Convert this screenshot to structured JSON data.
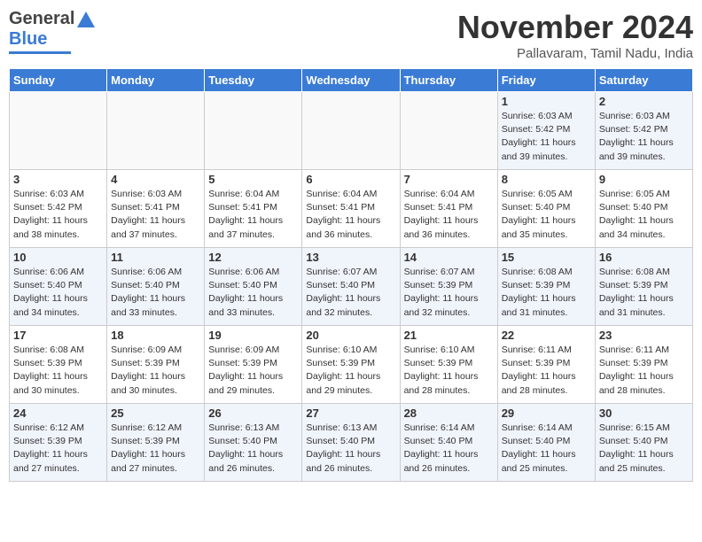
{
  "logo": {
    "general": "General",
    "blue": "Blue"
  },
  "header": {
    "month_title": "November 2024",
    "location": "Pallavaram, Tamil Nadu, India"
  },
  "weekdays": [
    "Sunday",
    "Monday",
    "Tuesday",
    "Wednesday",
    "Thursday",
    "Friday",
    "Saturday"
  ],
  "rows": [
    [
      {
        "day": "",
        "info": ""
      },
      {
        "day": "",
        "info": ""
      },
      {
        "day": "",
        "info": ""
      },
      {
        "day": "",
        "info": ""
      },
      {
        "day": "",
        "info": ""
      },
      {
        "day": "1",
        "info": "Sunrise: 6:03 AM\nSunset: 5:42 PM\nDaylight: 11 hours and 39 minutes."
      },
      {
        "day": "2",
        "info": "Sunrise: 6:03 AM\nSunset: 5:42 PM\nDaylight: 11 hours and 39 minutes."
      }
    ],
    [
      {
        "day": "3",
        "info": "Sunrise: 6:03 AM\nSunset: 5:42 PM\nDaylight: 11 hours and 38 minutes."
      },
      {
        "day": "4",
        "info": "Sunrise: 6:03 AM\nSunset: 5:41 PM\nDaylight: 11 hours and 37 minutes."
      },
      {
        "day": "5",
        "info": "Sunrise: 6:04 AM\nSunset: 5:41 PM\nDaylight: 11 hours and 37 minutes."
      },
      {
        "day": "6",
        "info": "Sunrise: 6:04 AM\nSunset: 5:41 PM\nDaylight: 11 hours and 36 minutes."
      },
      {
        "day": "7",
        "info": "Sunrise: 6:04 AM\nSunset: 5:41 PM\nDaylight: 11 hours and 36 minutes."
      },
      {
        "day": "8",
        "info": "Sunrise: 6:05 AM\nSunset: 5:40 PM\nDaylight: 11 hours and 35 minutes."
      },
      {
        "day": "9",
        "info": "Sunrise: 6:05 AM\nSunset: 5:40 PM\nDaylight: 11 hours and 34 minutes."
      }
    ],
    [
      {
        "day": "10",
        "info": "Sunrise: 6:06 AM\nSunset: 5:40 PM\nDaylight: 11 hours and 34 minutes."
      },
      {
        "day": "11",
        "info": "Sunrise: 6:06 AM\nSunset: 5:40 PM\nDaylight: 11 hours and 33 minutes."
      },
      {
        "day": "12",
        "info": "Sunrise: 6:06 AM\nSunset: 5:40 PM\nDaylight: 11 hours and 33 minutes."
      },
      {
        "day": "13",
        "info": "Sunrise: 6:07 AM\nSunset: 5:40 PM\nDaylight: 11 hours and 32 minutes."
      },
      {
        "day": "14",
        "info": "Sunrise: 6:07 AM\nSunset: 5:39 PM\nDaylight: 11 hours and 32 minutes."
      },
      {
        "day": "15",
        "info": "Sunrise: 6:08 AM\nSunset: 5:39 PM\nDaylight: 11 hours and 31 minutes."
      },
      {
        "day": "16",
        "info": "Sunrise: 6:08 AM\nSunset: 5:39 PM\nDaylight: 11 hours and 31 minutes."
      }
    ],
    [
      {
        "day": "17",
        "info": "Sunrise: 6:08 AM\nSunset: 5:39 PM\nDaylight: 11 hours and 30 minutes."
      },
      {
        "day": "18",
        "info": "Sunrise: 6:09 AM\nSunset: 5:39 PM\nDaylight: 11 hours and 30 minutes."
      },
      {
        "day": "19",
        "info": "Sunrise: 6:09 AM\nSunset: 5:39 PM\nDaylight: 11 hours and 29 minutes."
      },
      {
        "day": "20",
        "info": "Sunrise: 6:10 AM\nSunset: 5:39 PM\nDaylight: 11 hours and 29 minutes."
      },
      {
        "day": "21",
        "info": "Sunrise: 6:10 AM\nSunset: 5:39 PM\nDaylight: 11 hours and 28 minutes."
      },
      {
        "day": "22",
        "info": "Sunrise: 6:11 AM\nSunset: 5:39 PM\nDaylight: 11 hours and 28 minutes."
      },
      {
        "day": "23",
        "info": "Sunrise: 6:11 AM\nSunset: 5:39 PM\nDaylight: 11 hours and 28 minutes."
      }
    ],
    [
      {
        "day": "24",
        "info": "Sunrise: 6:12 AM\nSunset: 5:39 PM\nDaylight: 11 hours and 27 minutes."
      },
      {
        "day": "25",
        "info": "Sunrise: 6:12 AM\nSunset: 5:39 PM\nDaylight: 11 hours and 27 minutes."
      },
      {
        "day": "26",
        "info": "Sunrise: 6:13 AM\nSunset: 5:40 PM\nDaylight: 11 hours and 26 minutes."
      },
      {
        "day": "27",
        "info": "Sunrise: 6:13 AM\nSunset: 5:40 PM\nDaylight: 11 hours and 26 minutes."
      },
      {
        "day": "28",
        "info": "Sunrise: 6:14 AM\nSunset: 5:40 PM\nDaylight: 11 hours and 26 minutes."
      },
      {
        "day": "29",
        "info": "Sunrise: 6:14 AM\nSunset: 5:40 PM\nDaylight: 11 hours and 25 minutes."
      },
      {
        "day": "30",
        "info": "Sunrise: 6:15 AM\nSunset: 5:40 PM\nDaylight: 11 hours and 25 minutes."
      }
    ]
  ]
}
